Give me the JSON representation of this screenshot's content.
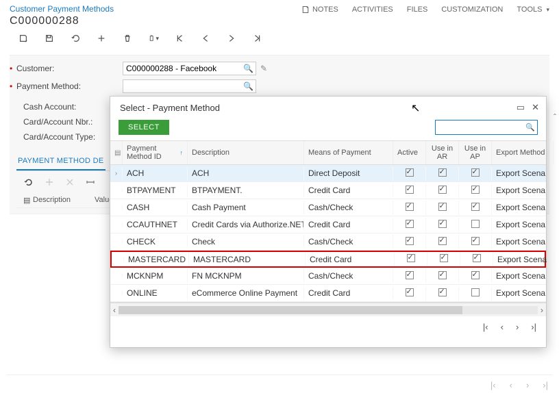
{
  "header": {
    "page_title_link": "Customer Payment Methods",
    "record_id": "C000000288",
    "actions": {
      "notes": "NOTES",
      "activities": "ACTIVITIES",
      "files": "FILES",
      "customization": "CUSTOMIZATION",
      "tools": "TOOLS"
    }
  },
  "form": {
    "customer_label": "Customer:",
    "customer_value": "C000000288 - Facebook",
    "payment_method_label": "Payment Method:",
    "payment_method_value": "",
    "cash_account_label": "Cash Account:",
    "card_account_nbr_label": "Card/Account Nbr.:",
    "card_account_type_label": "Card/Account Type:"
  },
  "tab": {
    "label": "PAYMENT METHOD DE"
  },
  "grid_below": {
    "col_desc": "Description",
    "col_value": "Value"
  },
  "popup": {
    "title": "Select - Payment Method",
    "select_label": "SELECT",
    "search_value": "",
    "columns": {
      "id": "Payment Method ID",
      "desc": "Description",
      "mop": "Means of Payment",
      "active": "Active",
      "ar": "Use in AR",
      "ap": "Use in AP",
      "export": "Export Method"
    },
    "rows": [
      {
        "id": "ACH",
        "desc": "ACH",
        "mop": "Direct Deposit",
        "active": true,
        "ar": true,
        "ap": true,
        "export": "Export Scena",
        "selected": true
      },
      {
        "id": "BTPAYMENT",
        "desc": "BTPAYMENT.",
        "mop": "Credit Card",
        "active": true,
        "ar": true,
        "ap": true,
        "export": "Export Scena"
      },
      {
        "id": "CASH",
        "desc": "Cash Payment",
        "mop": "Cash/Check",
        "active": true,
        "ar": true,
        "ap": true,
        "export": "Export Scena"
      },
      {
        "id": "CCAUTHNET",
        "desc": "Credit Cards via Authorize.NET",
        "mop": "Credit Card",
        "active": true,
        "ar": true,
        "ap": false,
        "export": "Export Scena"
      },
      {
        "id": "CHECK",
        "desc": "Check",
        "mop": "Cash/Check",
        "active": true,
        "ar": true,
        "ap": true,
        "export": "Export Scena"
      },
      {
        "id": "MASTERCARD",
        "desc": "MASTERCARD",
        "mop": "Credit Card",
        "active": true,
        "ar": true,
        "ap": true,
        "export": "Export Scena",
        "highlight": true
      },
      {
        "id": "MCKNPM",
        "desc": "FN MCKNPM",
        "mop": "Cash/Check",
        "active": true,
        "ar": true,
        "ap": true,
        "export": "Export Scena"
      },
      {
        "id": "ONLINE",
        "desc": "eCommerce Online Payment",
        "mop": "Credit Card",
        "active": true,
        "ar": true,
        "ap": false,
        "export": "Export Scena"
      }
    ]
  }
}
